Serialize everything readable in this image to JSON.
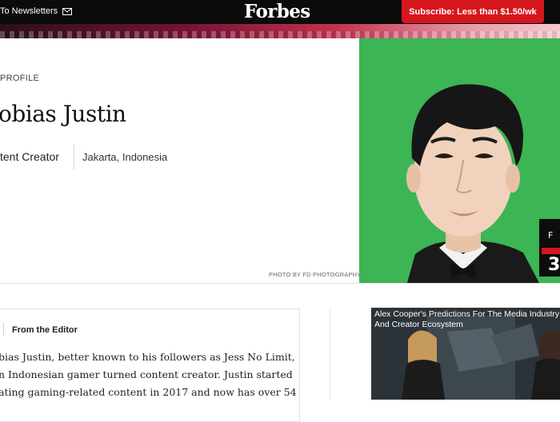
{
  "header": {
    "newsletter_label": "To Newsletters",
    "logo_text": "Forbes",
    "subscribe_label": "Subscribe: Less than $1.50/wk",
    "accent_color": "#d6171d"
  },
  "profile": {
    "category": "PROFILE",
    "name": "obias Justin",
    "role": "tent Creator",
    "location": "Jakarta, Indonesia",
    "photo_credit": "PHOTO BY FD PHOTOGRAPHY",
    "photo_background": "#3cb554"
  },
  "editor": {
    "label": "From the Editor",
    "lines": [
      "bias Justin, better known to his followers as Jess No Limit,",
      "n Indonesian gamer turned content creator. Justin started",
      "ating gaming-related content in 2017 and now has over 54"
    ]
  },
  "video": {
    "title": "Alex Cooper's Predictions For The Media Industry And Creator Ecosystem"
  }
}
